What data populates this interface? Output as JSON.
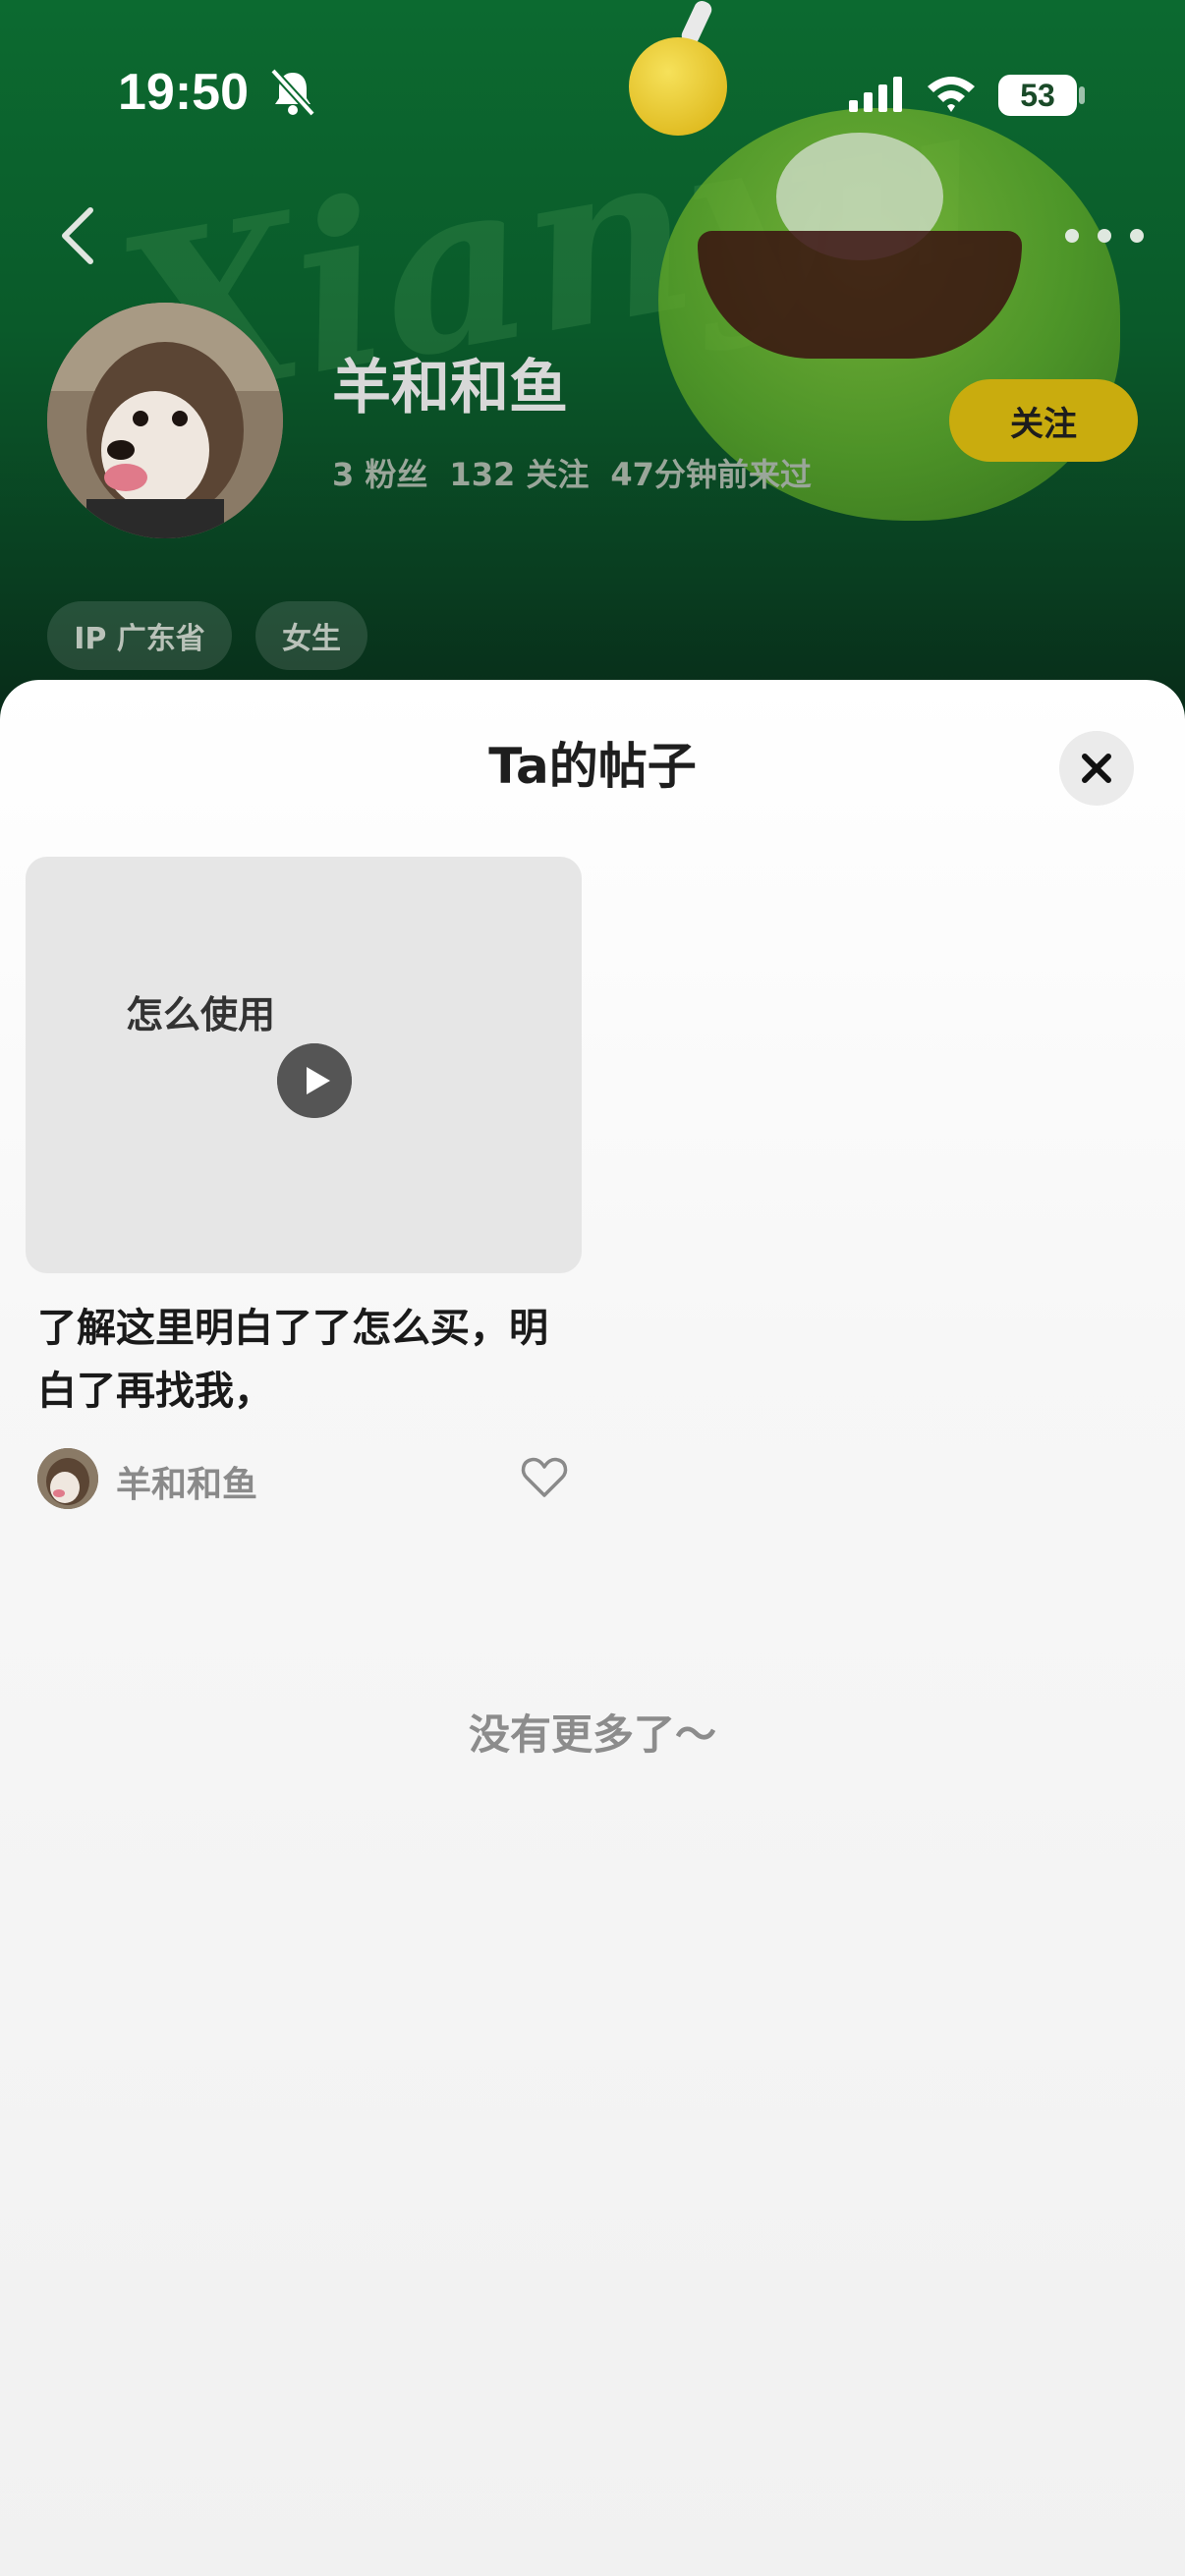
{
  "status_bar": {
    "time": "19:50",
    "battery": "53"
  },
  "header": {
    "watermark_text": "Xianyu",
    "profile": {
      "name": "羊和和鱼",
      "stats": [
        "3 粉丝",
        "132 关注",
        "47分钟前来过"
      ],
      "follow_label": "关注",
      "tags": [
        "IP 广东省",
        "女生"
      ]
    },
    "icons": {
      "back": "chevron-left-icon",
      "more": "more-dots-icon",
      "mute": "bell-slash-icon",
      "signal": "signal-icon",
      "wifi": "wifi-icon"
    }
  },
  "sheet": {
    "title": "Ta的帖子",
    "close_icon": "close-icon",
    "posts": [
      {
        "thumbnail_text": "怎么使用",
        "title": "了解这里明白了了怎么买，明白了再找我，",
        "author": "羊和和鱼",
        "play_icon": "play-icon",
        "like_icon": "heart-outline-icon"
      }
    ],
    "end_text": "没有更多了～"
  },
  "colors": {
    "header_green": "#0c6a30",
    "follow_button": "#c9ac0e",
    "sheet_bg": "#f3f3f3"
  }
}
